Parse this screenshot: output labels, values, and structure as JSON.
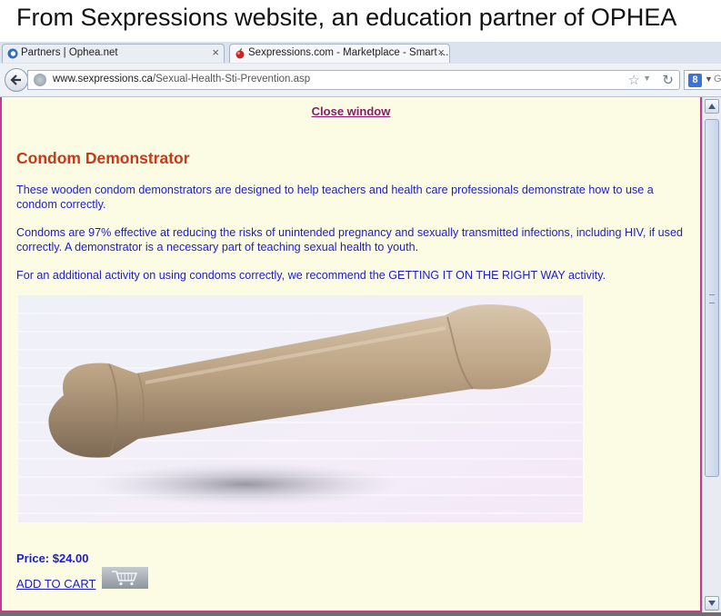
{
  "caption": "From Sexpressions website, an education partner of OPHEA",
  "browser": {
    "tabs": [
      {
        "label": "Partners | Ophea.net",
        "close": "×"
      },
      {
        "label": "Sexpressions.com - Marketplace - Smart ...",
        "close": "×"
      }
    ],
    "url_host": "www.sexpressions.ca",
    "url_path": "/Sexual-Health-Sti-Prevention.asp",
    "search_engine_letter": "8",
    "search_hint": "G"
  },
  "page": {
    "close_link": "Close window",
    "title": "Condom Demonstrator",
    "paragraphs": [
      "These wooden condom demonstrators are designed to help teachers and health care professionals demonstrate how to use a condom correctly.",
      "Condoms are 97% effective at reducing the risks of unintended pregnancy and sexually transmitted infections, including HIV, if used correctly. A demonstrator is a necessary part of teaching sexual health to youth.",
      "For an additional activity on using condoms correctly, we recommend the GETTING IT ON THE RIGHT WAY activity."
    ],
    "price": "Price: $24.00",
    "add_to_cart": "ADD TO CART"
  },
  "icons": {
    "back": "back-arrow-icon",
    "reload": "reload-icon",
    "star": "bookmark-star-icon",
    "cart": "shopping-cart-icon"
  },
  "colors": {
    "page_bg": "#fcfce5",
    "title": "#c8391a",
    "body_text": "#1c1ccc",
    "link": "#8b1a6b",
    "page_border": "#c23c8a"
  }
}
